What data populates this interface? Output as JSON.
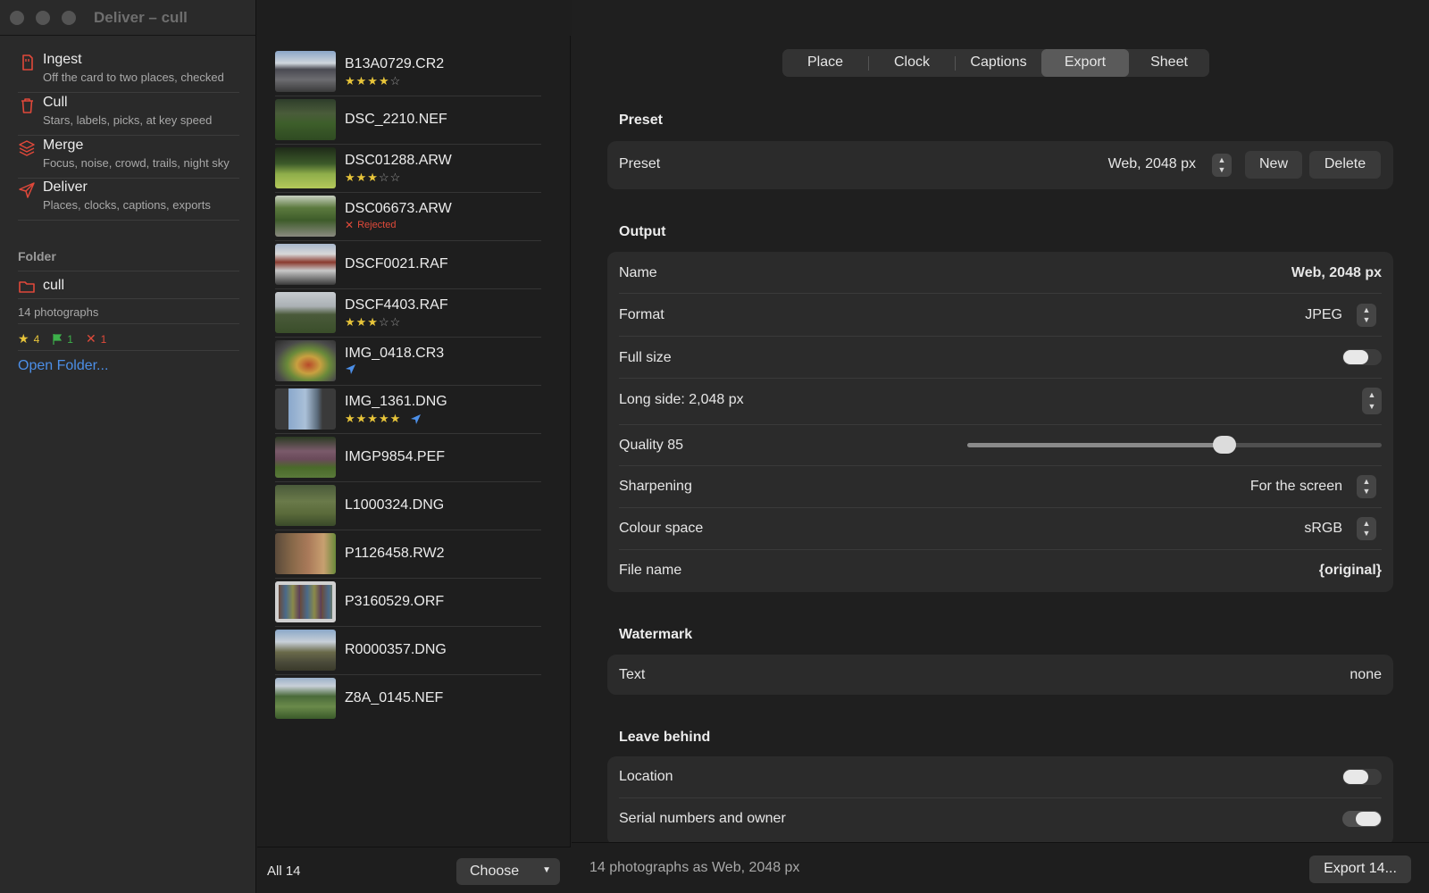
{
  "window": {
    "title": "Deliver – cull"
  },
  "sidebar": {
    "items": [
      {
        "title": "Ingest",
        "subtitle": "Off the card to two places, checked",
        "icon": "sd-card-icon"
      },
      {
        "title": "Cull",
        "subtitle": "Stars, labels, picks, at key speed",
        "icon": "trash-icon"
      },
      {
        "title": "Merge",
        "subtitle": "Focus, noise, crowd, trails, night sky",
        "icon": "layers-icon"
      },
      {
        "title": "Deliver",
        "subtitle": "Places, clocks, captions, exports",
        "icon": "paper-plane-icon"
      }
    ],
    "folder_heading": "Folder",
    "folder_name": "cull",
    "photo_count": "14 photographs",
    "badges": {
      "stars": "4",
      "flags": "1",
      "rejects": "1"
    },
    "open_folder": "Open Folder..."
  },
  "files": [
    {
      "name": "B13A0729.CR2",
      "stars": 4,
      "rejected": false,
      "located": false
    },
    {
      "name": "DSC_2210.NEF",
      "stars": 0,
      "rejected": false,
      "located": false
    },
    {
      "name": "DSC01288.ARW",
      "stars": 3,
      "rejected": false,
      "located": false
    },
    {
      "name": "DSC06673.ARW",
      "stars": 0,
      "rejected": true,
      "located": false
    },
    {
      "name": "DSCF0021.RAF",
      "stars": 0,
      "rejected": false,
      "located": false
    },
    {
      "name": "DSCF4403.RAF",
      "stars": 3,
      "rejected": false,
      "located": false
    },
    {
      "name": "IMG_0418.CR3",
      "stars": 0,
      "rejected": false,
      "located": true
    },
    {
      "name": "IMG_1361.DNG",
      "stars": 5,
      "rejected": false,
      "located": true
    },
    {
      "name": "IMGP9854.PEF",
      "stars": 0,
      "rejected": false,
      "located": false
    },
    {
      "name": "L1000324.DNG",
      "stars": 0,
      "rejected": false,
      "located": false
    },
    {
      "name": "P1126458.RW2",
      "stars": 0,
      "rejected": false,
      "located": false
    },
    {
      "name": "P3160529.ORF",
      "stars": 0,
      "rejected": false,
      "located": false
    },
    {
      "name": "R0000357.DNG",
      "stars": 0,
      "rejected": false,
      "located": false
    },
    {
      "name": "Z8A_0145.NEF",
      "stars": 0,
      "rejected": false,
      "located": false
    }
  ],
  "rejected_label": "Rejected",
  "list_footer": {
    "all_label": "All 14",
    "choose_label": "Choose"
  },
  "tabs": [
    {
      "label": "Place",
      "active": false
    },
    {
      "label": "Clock",
      "active": false
    },
    {
      "label": "Captions",
      "active": false
    },
    {
      "label": "Export",
      "active": true
    },
    {
      "label": "Sheet",
      "active": false
    }
  ],
  "preset": {
    "section": "Preset",
    "label": "Preset",
    "value": "Web, 2048 px",
    "new_label": "New",
    "delete_label": "Delete"
  },
  "output": {
    "section": "Output",
    "name_label": "Name",
    "name_value": "Web, 2048 px",
    "format_label": "Format",
    "format_value": "JPEG",
    "fullsize_label": "Full size",
    "fullsize_on": false,
    "longside_label": "Long side: 2,048 px",
    "quality_label": "Quality 85",
    "quality_level": 0.62,
    "sharpening_label": "Sharpening",
    "sharpening_value": "For the screen",
    "colour_label": "Colour space",
    "colour_value": "sRGB",
    "filename_label": "File name",
    "filename_value": "{original}"
  },
  "watermark": {
    "section": "Watermark",
    "text_label": "Text",
    "text_value": "none"
  },
  "leave_behind": {
    "section": "Leave behind",
    "location_label": "Location",
    "location_on": false,
    "serial_label": "Serial numbers and owner",
    "serial_on": true
  },
  "footer": {
    "summary": "14 photographs as Web, 2048 px",
    "export_label": "Export 14..."
  },
  "colors": {
    "accent": "#4c8fe8",
    "star": "#e8c53a",
    "reject": "#e04a3a",
    "flag": "#3db04a",
    "icon_red": "#e0483a"
  }
}
